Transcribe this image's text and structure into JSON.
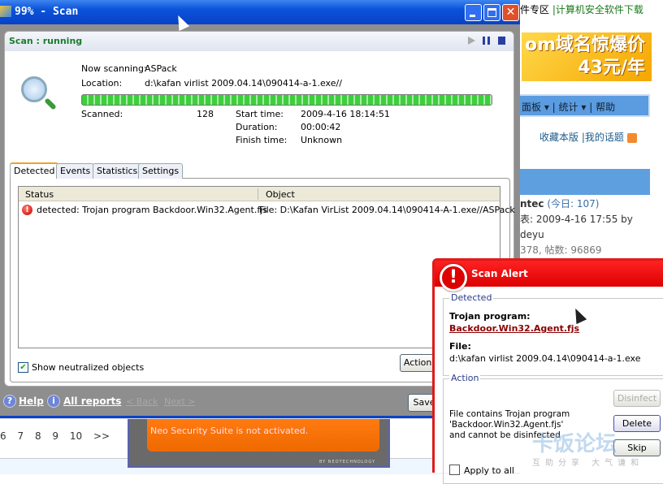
{
  "background_page": {
    "top_links": [
      "件专区",
      "|计算机安全软件下载"
    ],
    "banner": {
      "line1": "om域名惊爆价",
      "line2": "43元/年"
    },
    "nav": [
      "面板",
      "统计",
      "帮助"
    ],
    "links": [
      "收藏本版",
      "|我的话题"
    ],
    "forum_info": {
      "name": "ntec",
      "today": "(今日: 107)",
      "last_post": "表: 2009-4-16 17:55 by",
      "user": "deyu",
      "stats": "378, 帖数: 96869"
    },
    "pagination": [
      "6",
      "7",
      "8",
      "9",
      "10",
      ">>"
    ],
    "neo_banner": {
      "message": "Neo Security Suite is not activated.",
      "brand": "BY NEOTECHNOLOGY"
    }
  },
  "scan_window": {
    "title": "99% - Scan",
    "status": "Scan : running",
    "now_scanning_label": "Now scanning:",
    "now_scanning": "ASPack",
    "location_label": "Location:",
    "location": "d:\\kafan virlist 2009.04.14\\090414-a-1.exe//",
    "progress_percent": 99,
    "scanned_label": "Scanned:",
    "scanned": "128",
    "start_time_label": "Start time:",
    "start_time": "2009-4-16 18:14:51",
    "duration_label": "Duration:",
    "duration": "00:00:42",
    "finish_time_label": "Finish time:",
    "finish_time": "Unknown",
    "tabs": [
      "Detected",
      "Events",
      "Statistics",
      "Settings"
    ],
    "columns": [
      "Status",
      "Object"
    ],
    "rows": [
      {
        "status": "detected: Trojan program Backdoor.Win32.Agent.fjs",
        "object": "File: D:\\Kafan VirList 2009.04.14\\090414-A-1.exe//ASPack"
      }
    ],
    "show_neutralized_label": "Show neutralized objects",
    "show_neutralized": true,
    "actions_label": "Actions",
    "help_label": "Help",
    "all_reports_label": "All reports",
    "back_label": "< Back",
    "next_label": "Next >",
    "save_label": "Save"
  },
  "alert": {
    "title": "Scan Alert",
    "detected_legend": "Detected",
    "threat_type": "Trojan program:",
    "threat_name": "Backdoor.Win32.Agent.fjs",
    "file_label": "File:",
    "file_path": "d:\\kafan virlist 2009.04.14\\090414-a-1.exe",
    "action_legend": "Action",
    "message": "File contains Trojan program 'Backdoor.Win32.Agent.fjs' and cannot be disinfected",
    "disinfect_label": "Disinfect",
    "delete_label": "Delete",
    "skip_label": "Skip",
    "apply_all_label": "Apply to all",
    "watermark": "卡饭论坛",
    "watermark_sub": "互助分享  大气谦和"
  },
  "colors": {
    "title_blue": "#0a52d8",
    "status_green": "#1a7d2a",
    "alert_red": "#e01a1a",
    "threat_link": "#8b0000"
  }
}
